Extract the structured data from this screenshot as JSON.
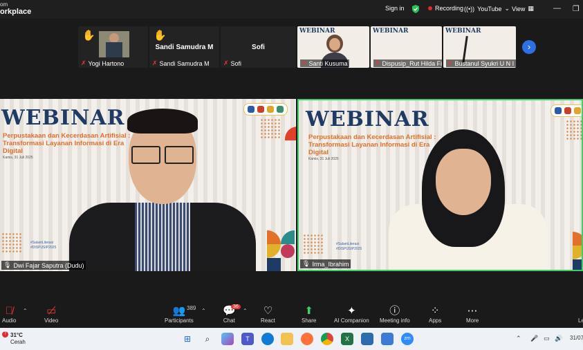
{
  "topbar": {
    "brand_line1": "om",
    "brand_line2": "orkplace",
    "signin": "Sign in",
    "recording": "Recording",
    "youtube": "YouTube",
    "view": "View"
  },
  "thumbnails": [
    {
      "name": "Yogi Hartono",
      "muted": true,
      "hand": true
    },
    {
      "name": "Sandi Samudra M",
      "display": "Sandi Samudra M",
      "muted": true,
      "hand": true
    },
    {
      "name": "Sofi",
      "display": "Sofi",
      "muted": true
    },
    {
      "name": "Santi Kusuma",
      "muted": true,
      "screen": "WEBINAR"
    },
    {
      "name": "Dispusip_Rut Hilda Fi...",
      "muted": true,
      "screen": "WEBINAR"
    },
    {
      "name": "Bustanul Syukri U N I B",
      "muted": true,
      "screen": "WEBINAR"
    }
  ],
  "webinar": {
    "title": "WEBINAR",
    "subtitle": "Perpustakaan dan Kecerdasan Artifisial : Transformasi Layanan Informasi di Era Digital",
    "date": "Kamis, 31 Juli 2025",
    "tag1": "#SalamLiterasi",
    "tag2": "#DISPUSIP2025"
  },
  "tiles": {
    "left_name": "Dwi Fajar Saputra (Dudu)",
    "right_name": "Irma_Ibrahim"
  },
  "toolbar": {
    "audio": "Audio",
    "video": "Video",
    "participants": "Participants",
    "participants_count": "389",
    "chat": "Chat",
    "chat_badge": "36",
    "react": "React",
    "share": "Share",
    "ai_companion": "AI Companion",
    "meeting_info": "Meeting info",
    "apps": "Apps",
    "more": "More",
    "leave": "Le"
  },
  "taskbar": {
    "temp": "31°C",
    "weather": "Cerah",
    "weather_badge": "7",
    "date": "31/07"
  },
  "colors": {
    "accent_blue": "#2f6fe0",
    "speaker_border": "#3ccf6a",
    "webinar_navy": "#1f3b63",
    "webinar_orange": "#e2702a",
    "recording_red": "#e02b2b"
  }
}
